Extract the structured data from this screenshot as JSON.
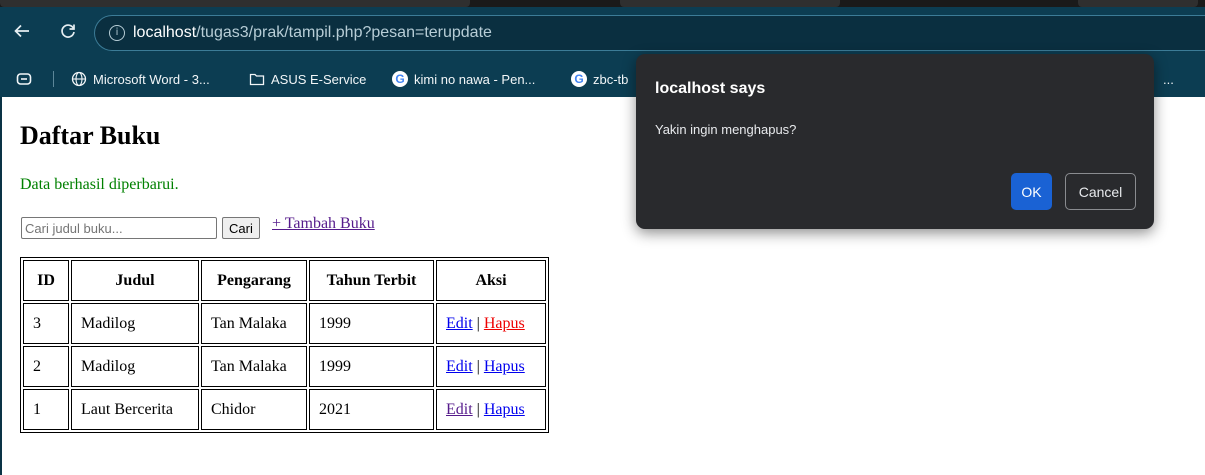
{
  "browser": {
    "url_host": "localhost",
    "url_path": "/tugas3/prak/tampil.php?pesan=terupdate",
    "bookmarks": [
      {
        "label": "Microsoft Word - 3...",
        "icon": "globe-icon"
      },
      {
        "label": "ASUS E-Service",
        "icon": "folder-icon"
      },
      {
        "label": "kimi no nawa - Pen...",
        "icon": "google-icon"
      },
      {
        "label": "zbc-tb",
        "icon": "google-icon"
      }
    ],
    "bookmark_overflow": "..."
  },
  "page": {
    "title": "Daftar Buku",
    "status_message": "Data berhasil diperbarui.",
    "search": {
      "placeholder": "Cari judul buku...",
      "value": "",
      "button_label": "Cari"
    },
    "add_link": "+ Tambah Buku",
    "table": {
      "headers": [
        "ID",
        "Judul",
        "Pengarang",
        "Tahun Terbit",
        "Aksi"
      ],
      "rows": [
        {
          "id": "3",
          "judul": "Madilog",
          "pengarang": "Tan Malaka",
          "tahun": "1999",
          "edit": "Edit",
          "separator": "|",
          "hapus": "Hapus"
        },
        {
          "id": "2",
          "judul": "Madilog",
          "pengarang": "Tan Malaka",
          "tahun": "1999",
          "edit": "Edit",
          "separator": "|",
          "hapus": "Hapus"
        },
        {
          "id": "1",
          "judul": "Laut Bercerita",
          "pengarang": "Chidor",
          "tahun": "2021",
          "edit": "Edit",
          "separator": "|",
          "hapus": "Hapus"
        }
      ]
    }
  },
  "dialog": {
    "title": "localhost says",
    "message": "Yakin ingin menghapus?",
    "ok_label": "OK",
    "cancel_label": "Cancel"
  },
  "colors": {
    "chrome_bg": "#0c3d52",
    "status_green": "#008000",
    "link_blue": "#0000ee",
    "link_visited": "#551a8b",
    "link_active_red": "#ee0000",
    "dialog_bg": "#292a2d",
    "dialog_ok_blue": "#1a62d4"
  }
}
